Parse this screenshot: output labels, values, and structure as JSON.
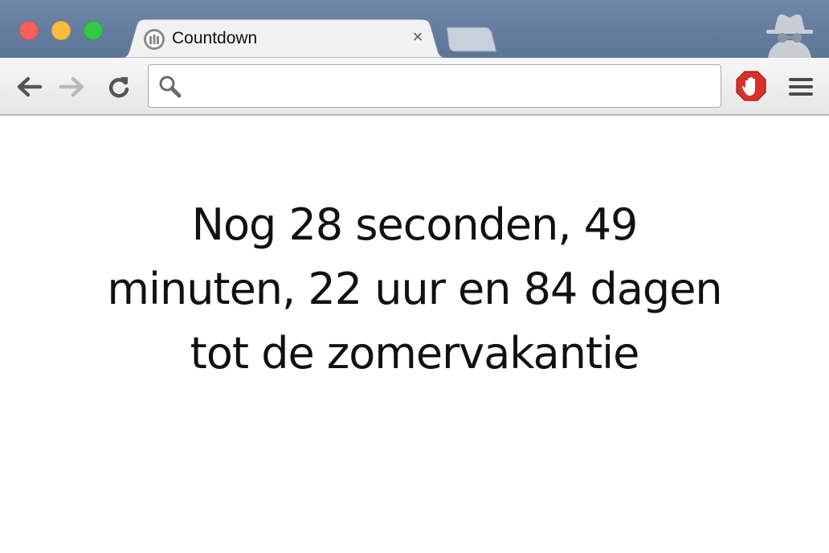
{
  "window": {
    "controls": [
      "close",
      "minimize",
      "zoom"
    ],
    "incognito_icon": "incognito-spy-icon"
  },
  "tab": {
    "title": "Countdown",
    "favicon": "countdown-favicon-icon",
    "close_glyph": "×"
  },
  "toolbar": {
    "back_icon": "back-arrow-icon",
    "forward_icon": "forward-arrow-icon",
    "reload_icon": "reload-icon",
    "omnibox": {
      "value": "",
      "placeholder": "",
      "icon": "search-icon"
    },
    "extension_icon": "adblock-hand-icon",
    "menu_icon": "hamburger-menu-icon"
  },
  "page": {
    "countdown_lines": [
      "Nog 28 seconden, 49",
      "minuten, 22 uur en 84 dagen",
      "tot de zomervakantie"
    ]
  },
  "colors": {
    "titlebar": "#5b7597",
    "adblock_red": "#d9302b"
  }
}
